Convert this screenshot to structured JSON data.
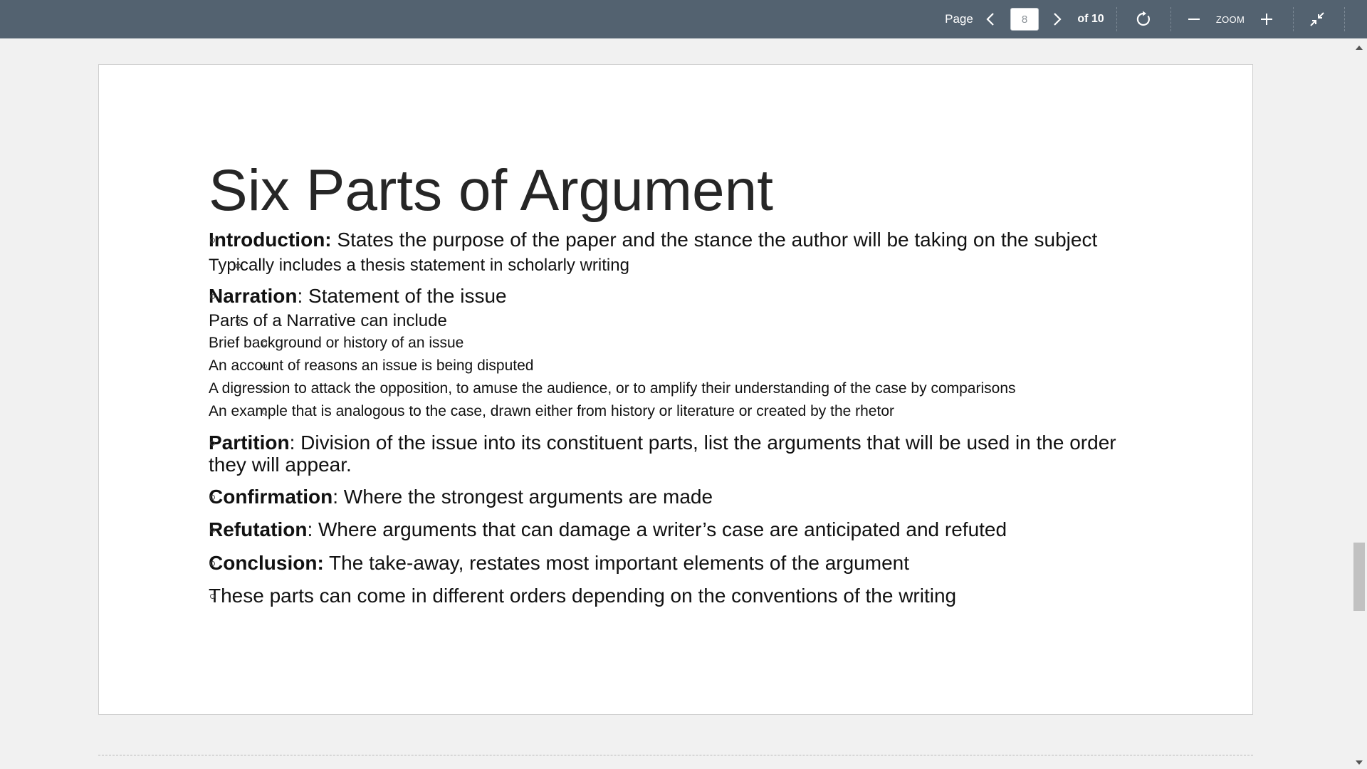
{
  "toolbar": {
    "page_label": "Page",
    "current_page": "8",
    "of_label": "of 10",
    "zoom_label": "ZOOM"
  },
  "slide": {
    "title": "Six Parts of Argument",
    "bullets": [
      {
        "level": 1,
        "term": "Introduction:",
        "text": " States the purpose of the paper and the stance the author will be taking on the subject"
      },
      {
        "level": 2,
        "term": "",
        "text": "Typically includes a thesis statement in scholarly writing"
      },
      {
        "level": 1,
        "term": "Narration",
        "text": ": Statement of the issue"
      },
      {
        "level": 2,
        "term": "",
        "text": "Parts of a Narrative can include"
      },
      {
        "level": 3,
        "term": "",
        "text": "Brief background or history of an issue"
      },
      {
        "level": 3,
        "term": "",
        "text": "An account of reasons an issue is being disputed"
      },
      {
        "level": 3,
        "term": "",
        "text": "A digression to attack the opposition, to amuse the audience, or to amplify their understanding of the case by comparisons"
      },
      {
        "level": 3,
        "term": "",
        "text": "An example that is analogous to the case, drawn either from history or literature or created by the rhetor"
      },
      {
        "level": 1,
        "term": "Partition",
        "text": ": Division of the issue into its constituent parts, list the arguments that will be used in the order they will appear."
      },
      {
        "level": 1,
        "term": "Confirmation",
        "text": ": Where the strongest arguments are made"
      },
      {
        "level": 1,
        "term": "Refutation",
        "text": ": Where arguments that can damage a writer’s case are anticipated and refuted"
      },
      {
        "level": 1,
        "term": "Conclusion:",
        "text": " The take-away, restates most important elements of the argument"
      },
      {
        "level": 1,
        "term": "",
        "text": "These parts can come in different orders depending on the conventions of the writing"
      }
    ]
  },
  "icons": {
    "prev": "chevron-left-icon",
    "next": "chevron-right-icon",
    "rotate": "rotate-icon",
    "zoom_out": "minus-icon",
    "zoom_in": "plus-icon",
    "collapse": "collapse-icon"
  },
  "colors": {
    "toolbar_bg": "#536270",
    "toolbar_text": "#ffffff",
    "viewer_bg": "#f1f1f1",
    "page_bg": "#ffffff"
  }
}
